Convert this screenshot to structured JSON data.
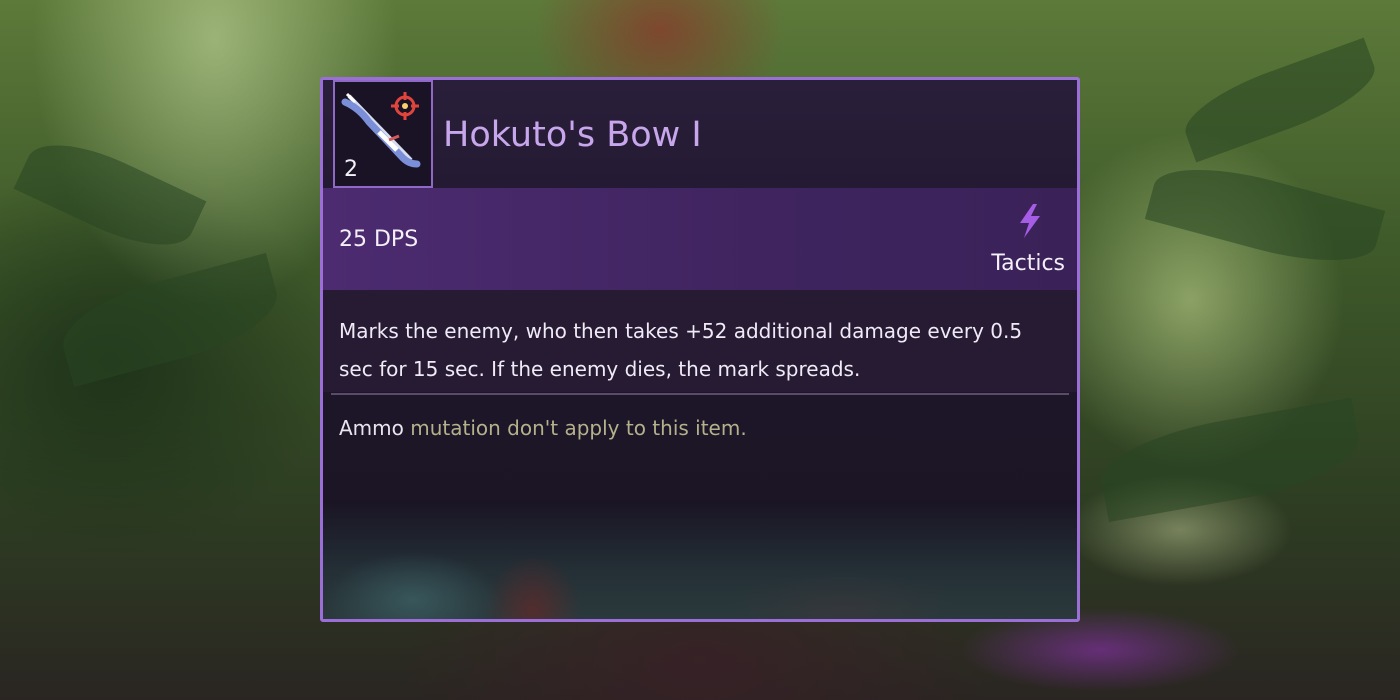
{
  "item": {
    "name": "Hokuto's Bow I",
    "tier": "2",
    "icon": "bow-with-crosshair-icon",
    "dps": "25 DPS",
    "category": {
      "label": "Tactics",
      "icon": "lightning-bolt-icon"
    },
    "description": "Marks the enemy, who then takes +52 additional damage every 0.5 sec for 15 sec. If the enemy dies, the mark spreads.",
    "note": {
      "keyword": "Ammo",
      "rest": " mutation don't apply to this item."
    }
  },
  "colors": {
    "border": "#9c6fd8",
    "title": "#c7a6ec",
    "tactics": "#a45de4",
    "stat_bar": "#4c2b70",
    "note_muted": "#b4b18b"
  }
}
